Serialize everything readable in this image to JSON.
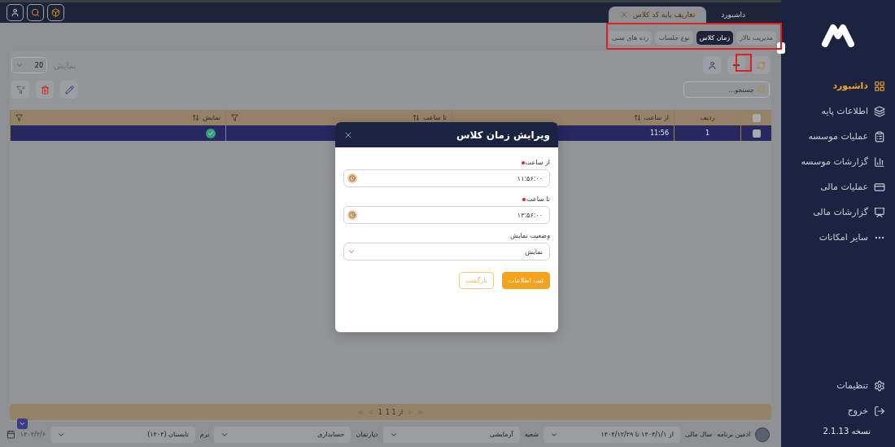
{
  "top_bar": {
    "tabs": [
      {
        "label": "داشبورد",
        "selected": false,
        "closable": false
      },
      {
        "label": "تعاریف پایه کد کلاس",
        "selected": true,
        "closable": true
      }
    ]
  },
  "sub_tabs": [
    {
      "label": "مدیریت تالار",
      "selected": false
    },
    {
      "label": "زمان کلاس",
      "selected": true
    },
    {
      "label": "نوع جلسات",
      "selected": false
    },
    {
      "label": "رده های سنی",
      "selected": false
    }
  ],
  "toolbar": {
    "search": {
      "placeholder": "جستجو..."
    },
    "page_size": {
      "label": "نمایش",
      "value": "20"
    }
  },
  "table": {
    "all_checked": false,
    "columns": [
      "ردیف",
      "از ساعت",
      "تا ساعت",
      "نمایش"
    ],
    "rows": [
      {
        "index": "1",
        "from": "11:56",
        "visible": true,
        "selected": true,
        "checked": false
      }
    ]
  },
  "pagination": {
    "text": "1 از 1",
    "page": "1"
  },
  "footer": {
    "user": "ادمین برنامه",
    "filters": [
      {
        "label": "سال مالی",
        "value": "از ۱۴۰۴/۱/۱ تا ۱۴۰۴/۱۲/۲۹"
      },
      {
        "label": "شعبه",
        "value": "آزمایشی"
      },
      {
        "label": "دپارتمان",
        "value": "حسابداری"
      },
      {
        "label": "ترم",
        "value": "تابستان (۱۴۰۴)"
      }
    ],
    "date": "۱۴۰۴/۴/۶"
  },
  "sidebar": {
    "items": [
      {
        "label": "داشبورد",
        "selected": true
      },
      {
        "label": "اطلاعات پایه",
        "selected": false
      },
      {
        "label": "عملیات موسسه",
        "selected": false
      },
      {
        "label": "گزارشات موسسه",
        "selected": false
      },
      {
        "label": "عملیات مالی",
        "selected": false
      },
      {
        "label": "گزارشات مالی",
        "selected": false
      },
      {
        "label": "سایر امکانات",
        "selected": false
      }
    ],
    "bottom_items": [
      "تنظیمات",
      "خروج"
    ],
    "version": "نسخه 2.1.13"
  },
  "modal": {
    "title": "ویرایش زمان کلاس",
    "fields": [
      {
        "kind": "time",
        "label": "از ساعت",
        "required": true,
        "value": "۱۱:۵۶:۰۰"
      },
      {
        "kind": "time",
        "label": "تا ساعت",
        "required": true,
        "value": "۱۳:۵۶:۰۰"
      },
      {
        "kind": "select",
        "label": "وضعیت نمایش",
        "required": false,
        "value": "نمایش"
      }
    ],
    "buttons": [
      {
        "label": "ثبت اطلاعات",
        "kind": "primary"
      },
      {
        "label": "بازگشت",
        "kind": "outline"
      }
    ]
  }
}
